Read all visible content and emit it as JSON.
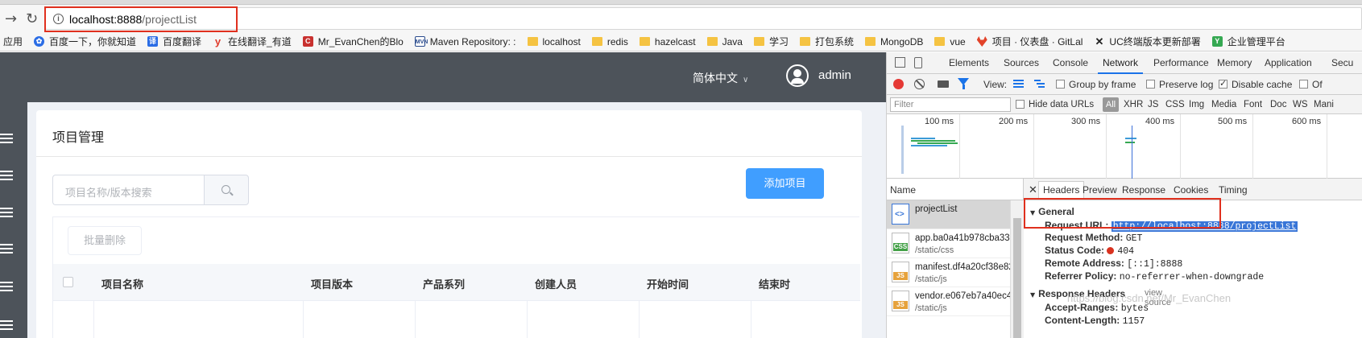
{
  "browser": {
    "url_host": "localhost:8888",
    "url_path": "/projectList",
    "bookmarks": [
      {
        "label": "应用",
        "icon": "apps-icon"
      },
      {
        "label": "百度一下，你就知道",
        "icon": "baidu-icon",
        "color": "#2b6de5"
      },
      {
        "label": "百度翻译",
        "icon": "fanyi-icon",
        "color": "#2b6de5"
      },
      {
        "label": "在线翻译_有道",
        "icon": "youdao-icon",
        "color": "#e03b2b"
      },
      {
        "label": "Mr_EvanChen的Blo",
        "icon": "csdn-icon",
        "color": "#c8312f"
      },
      {
        "label": "Maven Repository: :",
        "icon": "mvn-icon",
        "color": "#2a4b8d"
      },
      {
        "label": "localhost",
        "icon": "folder-icon"
      },
      {
        "label": "redis",
        "icon": "folder-icon"
      },
      {
        "label": "hazelcast",
        "icon": "folder-icon"
      },
      {
        "label": "Java",
        "icon": "folder-icon"
      },
      {
        "label": "学习",
        "icon": "folder-icon"
      },
      {
        "label": "打包系统",
        "icon": "folder-icon"
      },
      {
        "label": "MongoDB",
        "icon": "folder-icon"
      },
      {
        "label": "vue",
        "icon": "folder-icon"
      },
      {
        "label": "项目 · 仪表盘 · GitLal",
        "icon": "gitlab-icon",
        "color": "#e2432a"
      },
      {
        "label": "UC终端版本更新部署",
        "icon": "uc-icon",
        "color": "#222222"
      },
      {
        "label": "企业管理平台",
        "icon": "y-icon",
        "color": "#35a852"
      }
    ]
  },
  "app": {
    "language": "简体中文",
    "username": "admin",
    "page_title": "项目管理",
    "search_placeholder": "项目名称/版本搜索",
    "add_button": "添加项目",
    "batch_delete": "批量删除",
    "columns": [
      "项目名称",
      "项目版本",
      "产品系列",
      "创建人员",
      "开始时间",
      "结束时"
    ]
  },
  "devtools": {
    "tabs": [
      "Elements",
      "Sources",
      "Console",
      "Network",
      "Performance",
      "Memory",
      "Application",
      "Secu"
    ],
    "active_tab": "Network",
    "toolbar": {
      "view_label": "View:",
      "group_by_frame": "Group by frame",
      "preserve_log": "Preserve log",
      "disable_cache": "Disable cache",
      "offline": "Of"
    },
    "filter": {
      "placeholder": "Filter",
      "hide_data_urls": "Hide data URLs",
      "all": "All",
      "types": [
        "XHR",
        "JS",
        "CSS",
        "Img",
        "Media",
        "Font",
        "Doc",
        "WS",
        "Mani"
      ]
    },
    "timeline_ticks": [
      "100 ms",
      "200 ms",
      "300 ms",
      "400 ms",
      "500 ms",
      "600 ms"
    ],
    "name_header": "Name",
    "requests": [
      {
        "name": "projectList",
        "path": "",
        "type": "doc"
      },
      {
        "name": "app.ba0a41b978cba33b",
        "path": "/static/css",
        "type": "CSS"
      },
      {
        "name": "manifest.df4a20cf38e82",
        "path": "/static/js",
        "type": "JS"
      },
      {
        "name": "vendor.e067eb7a40ec40",
        "path": "/static/js",
        "type": "JS"
      }
    ],
    "detail_tabs": [
      "Headers",
      "Preview",
      "Response",
      "Cookies",
      "Timing"
    ],
    "general": {
      "title": "General",
      "request_url_k": "Request URL:",
      "request_url": "http://localhost:8888/projectList",
      "request_method_k": "Request Method:",
      "request_method": "GET",
      "status_code_k": "Status Code:",
      "status_code": "404",
      "remote_address_k": "Remote Address:",
      "remote_address": "[::1]:8888",
      "referrer_policy_k": "Referrer Policy:",
      "referrer_policy": "no-referrer-when-downgrade"
    },
    "response_headers": {
      "title": "Response Headers",
      "view_source": "view source",
      "accept_ranges_k": "Accept-Ranges:",
      "accept_ranges": "bytes",
      "content_length_k": "Content-Length:",
      "content_length": "1157"
    }
  },
  "watermark": "https://blog.csdn.net/Mr_EvanChen"
}
